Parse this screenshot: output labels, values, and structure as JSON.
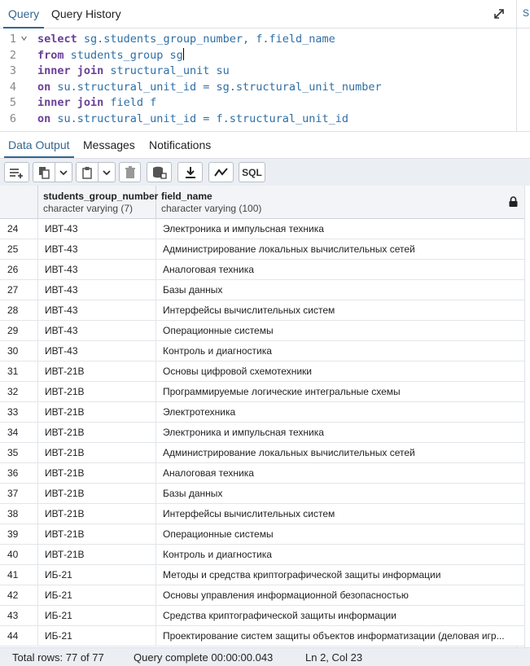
{
  "top_tabs": [
    {
      "label": "Query",
      "active": true
    },
    {
      "label": "Query History",
      "active": false
    }
  ],
  "right_panel_stub": "S",
  "editor": {
    "lines": [
      {
        "num": "1",
        "tokens": [
          [
            "kw",
            "select"
          ],
          [
            "id",
            " sg.students_group_number, f.field_name"
          ]
        ],
        "fold": true
      },
      {
        "num": "2",
        "tokens": [
          [
            "kw",
            "from"
          ],
          [
            "id",
            " students_group sg"
          ]
        ],
        "caret": true
      },
      {
        "num": "3",
        "tokens": [
          [
            "kw",
            "inner join"
          ],
          [
            "id",
            " structural_unit su"
          ]
        ]
      },
      {
        "num": "4",
        "tokens": [
          [
            "kw",
            "on"
          ],
          [
            "id",
            " su.structural_unit_id = sg.structural_unit_number"
          ]
        ]
      },
      {
        "num": "5",
        "tokens": [
          [
            "kw",
            "inner join"
          ],
          [
            "id",
            " field f"
          ]
        ]
      },
      {
        "num": "6",
        "tokens": [
          [
            "kw",
            "on"
          ],
          [
            "id",
            " su.structural_unit_id = f.structural_unit_id"
          ]
        ]
      }
    ]
  },
  "output_tabs": [
    {
      "label": "Data Output",
      "active": true
    },
    {
      "label": "Messages",
      "active": false
    },
    {
      "label": "Notifications",
      "active": false
    }
  ],
  "toolbar": {
    "sql_label": "SQL",
    "icons": [
      "add-row-icon",
      "copy-icon",
      "dropdown-icon",
      "paste-icon",
      "dropdown-icon",
      "delete-icon",
      "save-data-icon",
      "download-icon",
      "graph-icon"
    ]
  },
  "grid": {
    "columns": [
      {
        "name": "students_group_number",
        "type": "character varying (7)"
      },
      {
        "name": "field_name",
        "type": "character varying (100)"
      }
    ],
    "rows": [
      [
        "24",
        "ИВТ-43",
        "Электроника и импульсная техника"
      ],
      [
        "25",
        "ИВТ-43",
        "Администрирование локальных вычислительных сетей"
      ],
      [
        "26",
        "ИВТ-43",
        "Аналоговая техника"
      ],
      [
        "27",
        "ИВТ-43",
        "Базы данных"
      ],
      [
        "28",
        "ИВТ-43",
        "Интерфейсы вычислительных систем"
      ],
      [
        "29",
        "ИВТ-43",
        "Операционные системы"
      ],
      [
        "30",
        "ИВТ-43",
        "Контроль и диагностика"
      ],
      [
        "31",
        "ИВТ-21В",
        "Основы цифровой схемотехники"
      ],
      [
        "32",
        "ИВТ-21В",
        "Программируемые логические интегральные схемы"
      ],
      [
        "33",
        "ИВТ-21В",
        "Электротехника"
      ],
      [
        "34",
        "ИВТ-21В",
        "Электроника и импульсная техника"
      ],
      [
        "35",
        "ИВТ-21В",
        "Администрирование локальных вычислительных сетей"
      ],
      [
        "36",
        "ИВТ-21В",
        "Аналоговая техника"
      ],
      [
        "37",
        "ИВТ-21В",
        "Базы данных"
      ],
      [
        "38",
        "ИВТ-21В",
        "Интерфейсы вычислительных систем"
      ],
      [
        "39",
        "ИВТ-21В",
        "Операционные системы"
      ],
      [
        "40",
        "ИВТ-21В",
        "Контроль и диагностика"
      ],
      [
        "41",
        "ИБ-21",
        "Методы и средства криптографической защиты информации"
      ],
      [
        "42",
        "ИБ-21",
        "Основы управления информационной безопасностью"
      ],
      [
        "43",
        "ИБ-21",
        "Средства криптографической защиты информации"
      ],
      [
        "44",
        "ИБ-21",
        "Проектирование систем защиты объектов информатизации (деловая игр..."
      ]
    ]
  },
  "status": {
    "total_rows": "Total rows: 77 of 77",
    "query_complete": "Query complete 00:00:00.043",
    "cursor": "Ln 2, Col 23"
  },
  "colors": {
    "accent": "#326690",
    "keyword": "#6a3f97",
    "identifier": "#2f6ea5"
  }
}
